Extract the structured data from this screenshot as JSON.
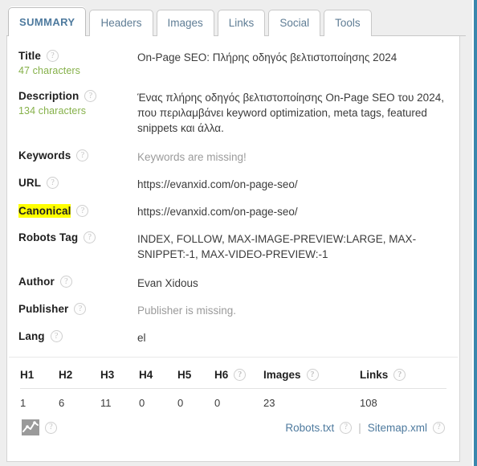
{
  "tabs": [
    {
      "label": "SUMMARY",
      "active": true
    },
    {
      "label": "Headers",
      "active": false
    },
    {
      "label": "Images",
      "active": false
    },
    {
      "label": "Links",
      "active": false
    },
    {
      "label": "Social",
      "active": false
    },
    {
      "label": "Tools",
      "active": false
    }
  ],
  "help_glyph": "?",
  "summary": {
    "title": {
      "label": "Title",
      "char_count": "47 characters",
      "value": "On-Page SEO: Πλήρης οδηγός βελτιστοποίησης 2024"
    },
    "description": {
      "label": "Description",
      "char_count": "134 characters",
      "value": "Ένας πλήρης οδηγός βελτιστοποίησης On-Page SEO του 2024, που περιλαμβάνει keyword optimization, meta tags, featured snippets και άλλα."
    },
    "keywords": {
      "label": "Keywords",
      "value": "Keywords are missing!"
    },
    "url": {
      "label": "URL",
      "value": "https://evanxid.com/on-page-seo/"
    },
    "canonical": {
      "label": "Canonical",
      "value": "https://evanxid.com/on-page-seo/"
    },
    "robots_tag": {
      "label": "Robots Tag",
      "value": "INDEX, FOLLOW, MAX-IMAGE-PREVIEW:LARGE, MAX-SNIPPET:-1, MAX-VIDEO-PREVIEW:-1"
    },
    "author": {
      "label": "Author",
      "value": "Evan Xidous"
    },
    "publisher": {
      "label": "Publisher",
      "value": "Publisher is missing."
    },
    "lang": {
      "label": "Lang",
      "value": "el"
    }
  },
  "stats": {
    "headers": [
      {
        "label": "H1",
        "help": false
      },
      {
        "label": "H2",
        "help": false
      },
      {
        "label": "H3",
        "help": false
      },
      {
        "label": "H4",
        "help": false
      },
      {
        "label": "H5",
        "help": false
      },
      {
        "label": "H6",
        "help": true
      },
      {
        "label": "Images",
        "help": true
      },
      {
        "label": "Links",
        "help": true
      }
    ],
    "values": [
      "1",
      "6",
      "11",
      "0",
      "0",
      "0",
      "23",
      "108"
    ]
  },
  "footer": {
    "robots_link": "Robots.txt",
    "separator": "|",
    "sitemap_link": "Sitemap.xml"
  },
  "colors": {
    "accent_blue": "#4e7a9e",
    "edge_strip": "#3a87ad",
    "char_count_green": "#86b14a",
    "highlight_yellow": "#ffff00",
    "muted_gray": "#9b9b9b"
  }
}
